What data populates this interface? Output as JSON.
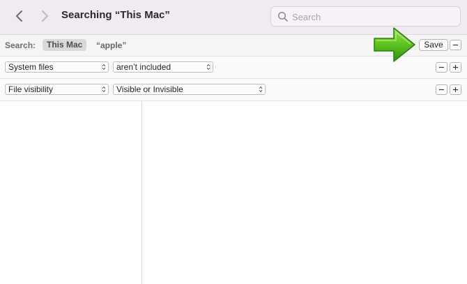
{
  "window": {
    "title": "Searching “This Mac”"
  },
  "toolbar": {
    "back_icon": "chevron-left-icon",
    "forward_icon": "chevron-right-icon",
    "search": {
      "placeholder": "Search",
      "value": "",
      "icon": "magnifier-icon"
    }
  },
  "scope_bar": {
    "label": "Search:",
    "scope": "This Mac",
    "term": "“apple”",
    "save_label": "Save"
  },
  "criteria": [
    {
      "attribute": "System files",
      "operator": "aren’t included"
    },
    {
      "attribute": "File visibility",
      "operator": "Visible or Invisible"
    }
  ],
  "annotation": {
    "icon": "green-arrow-icon",
    "color": "#4fb81c"
  },
  "colors": {
    "toolbar_bg": "#f1eaf3",
    "accent_arrow": "#4fb81c"
  }
}
